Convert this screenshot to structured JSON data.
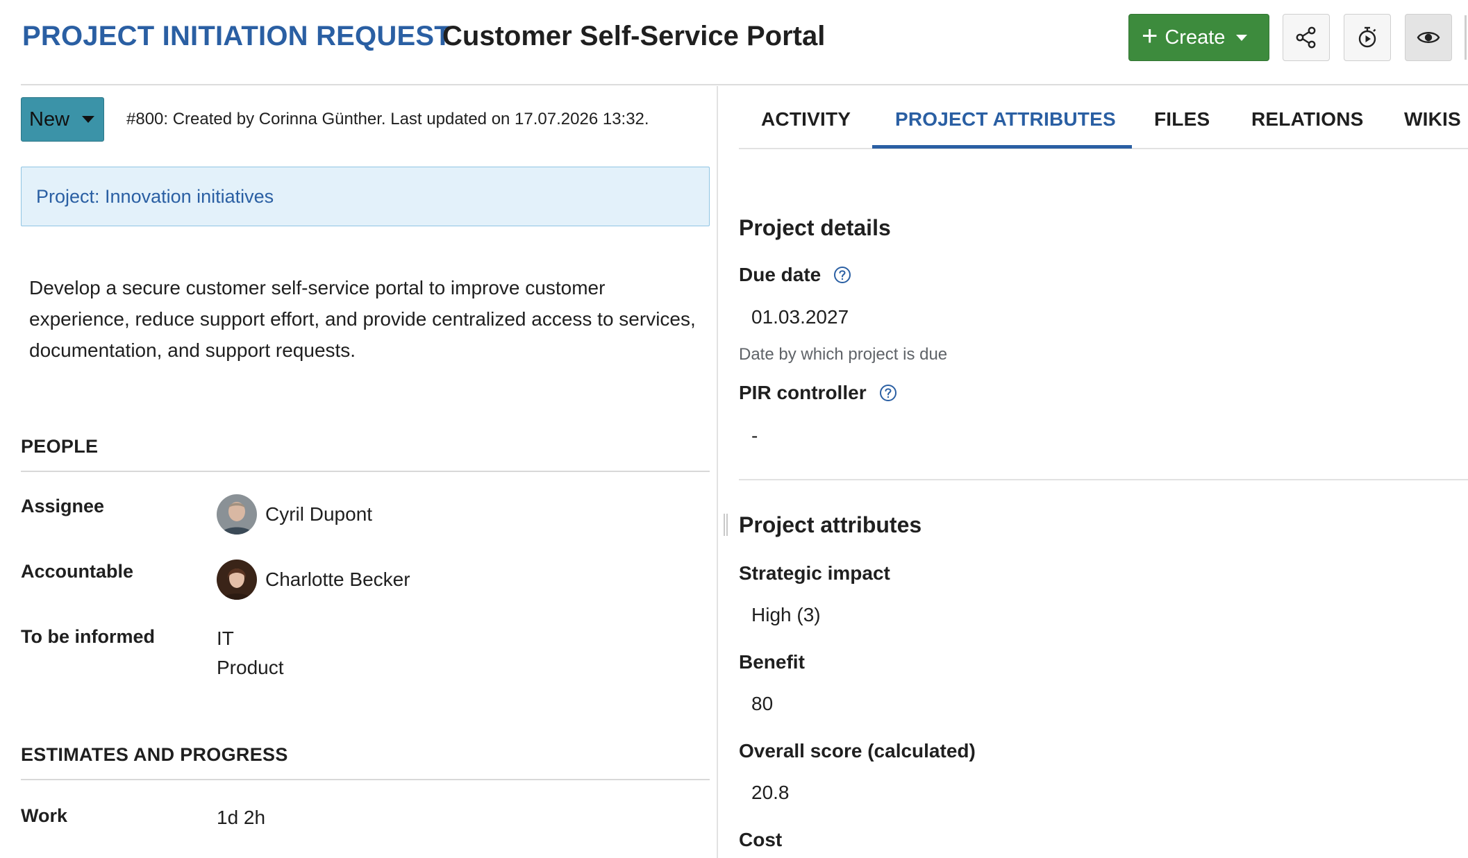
{
  "header": {
    "type_label": "PROJECT INITIATION REQUEST",
    "subject": "Customer Self-Service Portal",
    "create_label": "Create",
    "icons": [
      "share-icon",
      "timer-icon",
      "watch-eye-icon"
    ]
  },
  "status": {
    "label": "New",
    "meta": "#800: Created by Corinna Günther. Last updated on 17.07.2026 13:32."
  },
  "project_banner": "Project: Innovation initiatives",
  "description": "Develop a secure customer self-service portal to improve customer experience, reduce support effort, and provide centralized access to services, documentation, and support requests.",
  "people": {
    "title": "PEOPLE",
    "assignee_label": "Assignee",
    "assignee": "Cyril Dupont",
    "accountable_label": "Accountable",
    "accountable": "Charlotte Becker",
    "informed_label": "To be informed",
    "informed": [
      "IT",
      "Product"
    ]
  },
  "estimates": {
    "title": "ESTIMATES AND PROGRESS",
    "work_label": "Work",
    "work": "1d 2h"
  },
  "tabs": [
    "ACTIVITY",
    "PROJECT ATTRIBUTES",
    "FILES",
    "RELATIONS",
    "WIKIS"
  ],
  "active_tab": "PROJECT ATTRIBUTES",
  "project_details": {
    "title": "Project details",
    "due_date_label": "Due date",
    "due_date": "01.03.2027",
    "due_date_help": "Date by which project is due",
    "controller_label": "PIR controller",
    "controller": "-"
  },
  "project_attributes": {
    "title": "Project attributes",
    "strategic_label": "Strategic impact",
    "strategic": "High (3)",
    "benefit_label": "Benefit",
    "benefit": "80",
    "score_label": "Overall score (calculated)",
    "score": "20.8",
    "cost_label": "Cost"
  },
  "colors": {
    "accent_blue": "#2a5fa3",
    "create_green": "#3d8b3d",
    "status_teal": "#3b93a8",
    "banner_bg": "#e3f1fa"
  }
}
